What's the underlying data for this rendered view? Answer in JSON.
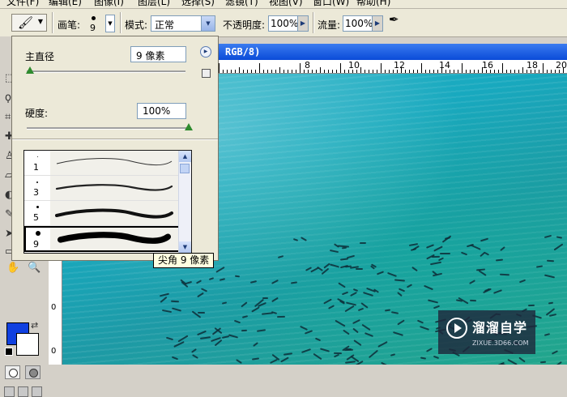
{
  "menu": [
    "文件(F)",
    "编辑(E)",
    "图像(I)",
    "图层(L)",
    "选择(S)",
    "滤镜(T)",
    "视图(V)",
    "窗口(W)",
    "帮助(H)"
  ],
  "options_bar": {
    "brush_label": "画笔:",
    "brush_size": "9",
    "mode_label": "模式:",
    "mode_value": "正常",
    "opacity_label": "不透明度:",
    "opacity_value": "100%",
    "flow_label": "流量:",
    "flow_value": "100%",
    "icons": [
      "brush-icon",
      "airbrush-icon"
    ]
  },
  "brush_panel": {
    "master_diameter_label": "主直径",
    "master_diameter_value": "9 像素",
    "master_diameter_level": 0.02,
    "hardness_label": "硬度:",
    "hardness_value": "100%",
    "hardness_level": 1.0,
    "presets": [
      {
        "size": "1"
      },
      {
        "size": "3"
      },
      {
        "size": "5"
      },
      {
        "size": "9",
        "selected": true
      }
    ],
    "tooltip": "尖角 9 像素"
  },
  "document": {
    "title": "RGB/8)",
    "ruler_top": [
      "8",
      "10",
      "12",
      "14",
      "16",
      "18",
      "20"
    ],
    "ruler_left": [
      "0",
      "0"
    ]
  },
  "watermark": {
    "name": "溜溜自学",
    "url": "ZIXUE.3D66.COM"
  },
  "colors": {
    "foreground": "#1040e0",
    "background": "#ffffff",
    "title_bar": "#0a4bd8"
  }
}
